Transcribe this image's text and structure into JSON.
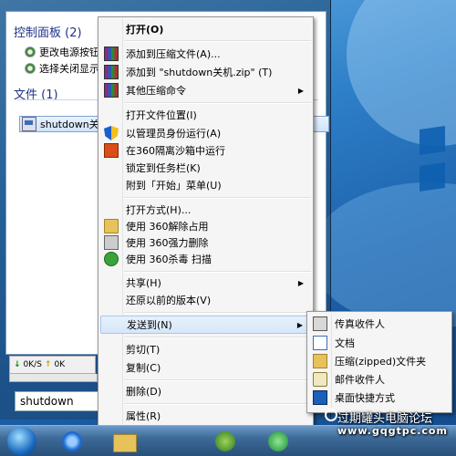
{
  "start_menu": {
    "control_panel_group": "控制面板 (2)",
    "control_panel_items": [
      "更改电源按钮",
      "选择关闭显示"
    ],
    "files_group": "文件 (1)",
    "file_item": "shutdown关",
    "search_value": "shutdown",
    "net_down": "0K/S",
    "net_up": "0K"
  },
  "context_menu": {
    "items": [
      {
        "label": "打开(O)",
        "icon": "none",
        "bold": true
      },
      {
        "label": "添加到压缩文件(A)...",
        "icon": "winrar-icon"
      },
      {
        "label": "添加到 \"shutdown关机.zip\" (T)",
        "icon": "winrar-icon"
      },
      {
        "label": "其他压缩命令",
        "icon": "winrar-icon",
        "submenu": true
      },
      {
        "label": "打开文件位置(I)",
        "icon": "none"
      },
      {
        "label": "以管理员身份运行(A)",
        "icon": "uac-shield-icon"
      },
      {
        "label": "在360隔离沙箱中运行",
        "icon": "360-sandbox-icon"
      },
      {
        "label": "锁定到任务栏(K)",
        "icon": "none"
      },
      {
        "label": "附到「开始」菜单(U)",
        "icon": "none"
      },
      {
        "label": "打开方式(H)...",
        "icon": "none"
      },
      {
        "label": "使用 360解除占用",
        "icon": "folder-icon"
      },
      {
        "label": "使用 360强力删除",
        "icon": "shredder-icon"
      },
      {
        "label": "使用 360杀毒 扫描",
        "icon": "360-antivirus-icon"
      },
      {
        "label": "共享(H)",
        "icon": "none",
        "submenu": true
      },
      {
        "label": "还原以前的版本(V)",
        "icon": "none"
      },
      {
        "label": "发送到(N)",
        "icon": "none",
        "submenu": true,
        "highlighted": true
      },
      {
        "label": "剪切(T)",
        "icon": "none"
      },
      {
        "label": "复制(C)",
        "icon": "none"
      },
      {
        "label": "删除(D)",
        "icon": "none"
      },
      {
        "label": "属性(R)",
        "icon": "none"
      }
    ]
  },
  "send_to_menu": {
    "items": [
      {
        "label": "传真收件人",
        "icon": "fax-icon"
      },
      {
        "label": "文档",
        "icon": "documents-icon"
      },
      {
        "label": "压缩(zipped)文件夹",
        "icon": "zip-folder-icon"
      },
      {
        "label": "邮件收件人",
        "icon": "mail-icon"
      },
      {
        "label": "桌面快捷方式",
        "icon": "desktop-icon"
      }
    ]
  },
  "watermark": {
    "line1": "过期罐头电脑论坛",
    "line2": "www.gqgtpc.com"
  }
}
